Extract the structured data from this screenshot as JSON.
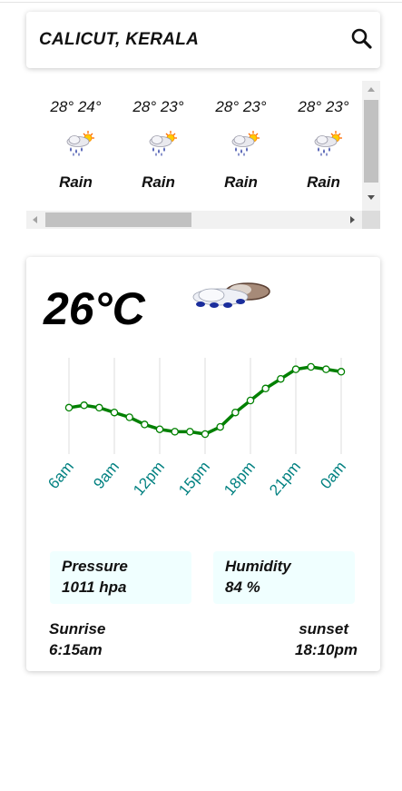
{
  "search": {
    "city": "CALICUT, KERALA",
    "icon": "search-icon"
  },
  "forecast": [
    {
      "temp": "28° 24°",
      "label": "Rain",
      "icon": "rain-icon"
    },
    {
      "temp": "28° 23°",
      "label": "Rain",
      "icon": "rain-icon"
    },
    {
      "temp": "28° 23°",
      "label": "Rain",
      "icon": "rain-icon"
    },
    {
      "temp": "28° 23°",
      "label": "Rain",
      "icon": "rain-icon"
    }
  ],
  "current": {
    "temp": "26°C",
    "icon": "cloud-icon"
  },
  "stats": {
    "pressure_label": "Pressure",
    "pressure_value": "1011 hpa",
    "humidity_label": "Humidity",
    "humidity_value": "84 %"
  },
  "sun": {
    "sunrise_label": "Sunrise",
    "sunrise_value": "6:15am",
    "sunset_label": "sunset",
    "sunset_value": "18:10pm"
  },
  "colors": {
    "line": "#008000",
    "tick_label": "#008080",
    "stat_bg": "#f0ffff"
  },
  "chart_data": {
    "type": "line",
    "x": [
      "6am",
      "9am",
      "12pm",
      "15pm",
      "18pm",
      "21pm",
      "0am"
    ],
    "series": [
      {
        "values": [
          25.8,
          25.9,
          25.8,
          25.6,
          25.4,
          25.1,
          24.9,
          24.8,
          24.8,
          24.7,
          25.0,
          25.6,
          26.1,
          26.6,
          27.0,
          27.4,
          27.5,
          27.4,
          27.3
        ]
      }
    ],
    "grid": "vertical",
    "xlabel": "",
    "ylabel": ""
  }
}
